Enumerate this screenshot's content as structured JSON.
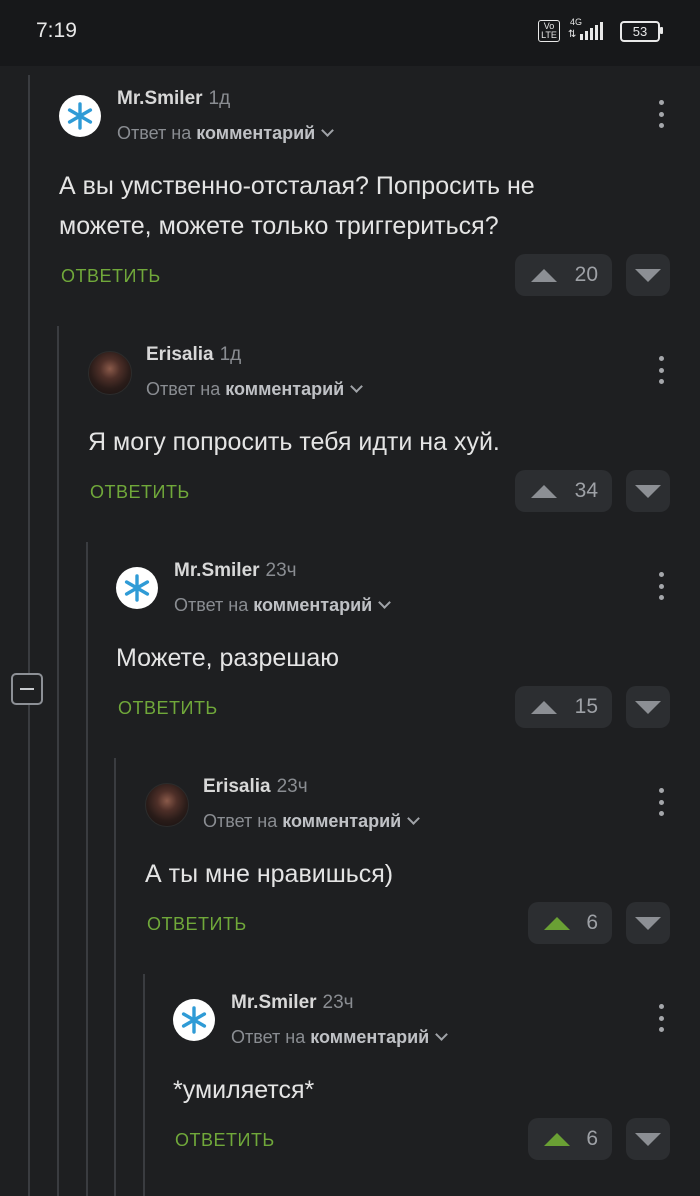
{
  "status_bar": {
    "time": "7:19",
    "volte": "Vo LTE",
    "network": "4G",
    "battery": "53"
  },
  "reply_prefix": "Ответ на",
  "reply_target": "комментарий",
  "reply_label": "ОТВЕТИТЬ",
  "comments": [
    {
      "author": "Mr.Smiler",
      "age": "1д",
      "avatar": "snowflake-avatar",
      "text_lines": [
        "А вы умственно-отсталая? Попросить не",
        "можете, можете только триггериться?"
      ],
      "votes": "20",
      "upvoted": false
    },
    {
      "author": "Erisalia",
      "age": "1д",
      "avatar": "photo-avatar",
      "text_lines": [
        "Я могу попросить тебя идти на хуй."
      ],
      "votes": "34",
      "upvoted": false
    },
    {
      "author": "Mr.Smiler",
      "age": "23ч",
      "avatar": "snowflake-avatar",
      "text_lines": [
        "Можете, разрешаю"
      ],
      "votes": "15",
      "upvoted": false
    },
    {
      "author": "Erisalia",
      "age": "23ч",
      "avatar": "photo-avatar",
      "text_lines": [
        "А ты мне нравишься)"
      ],
      "votes": "6",
      "upvoted": true
    },
    {
      "author": "Mr.Smiler",
      "age": "23ч",
      "avatar": "snowflake-avatar",
      "text_lines": [
        "*умиляется*"
      ],
      "votes": "6",
      "upvoted": true
    }
  ],
  "colors": {
    "background": "#1e1f21",
    "reply_green": "#70a83a",
    "upvote_green": "#6aa034",
    "snowflake_blue": "#2f9bd6"
  }
}
